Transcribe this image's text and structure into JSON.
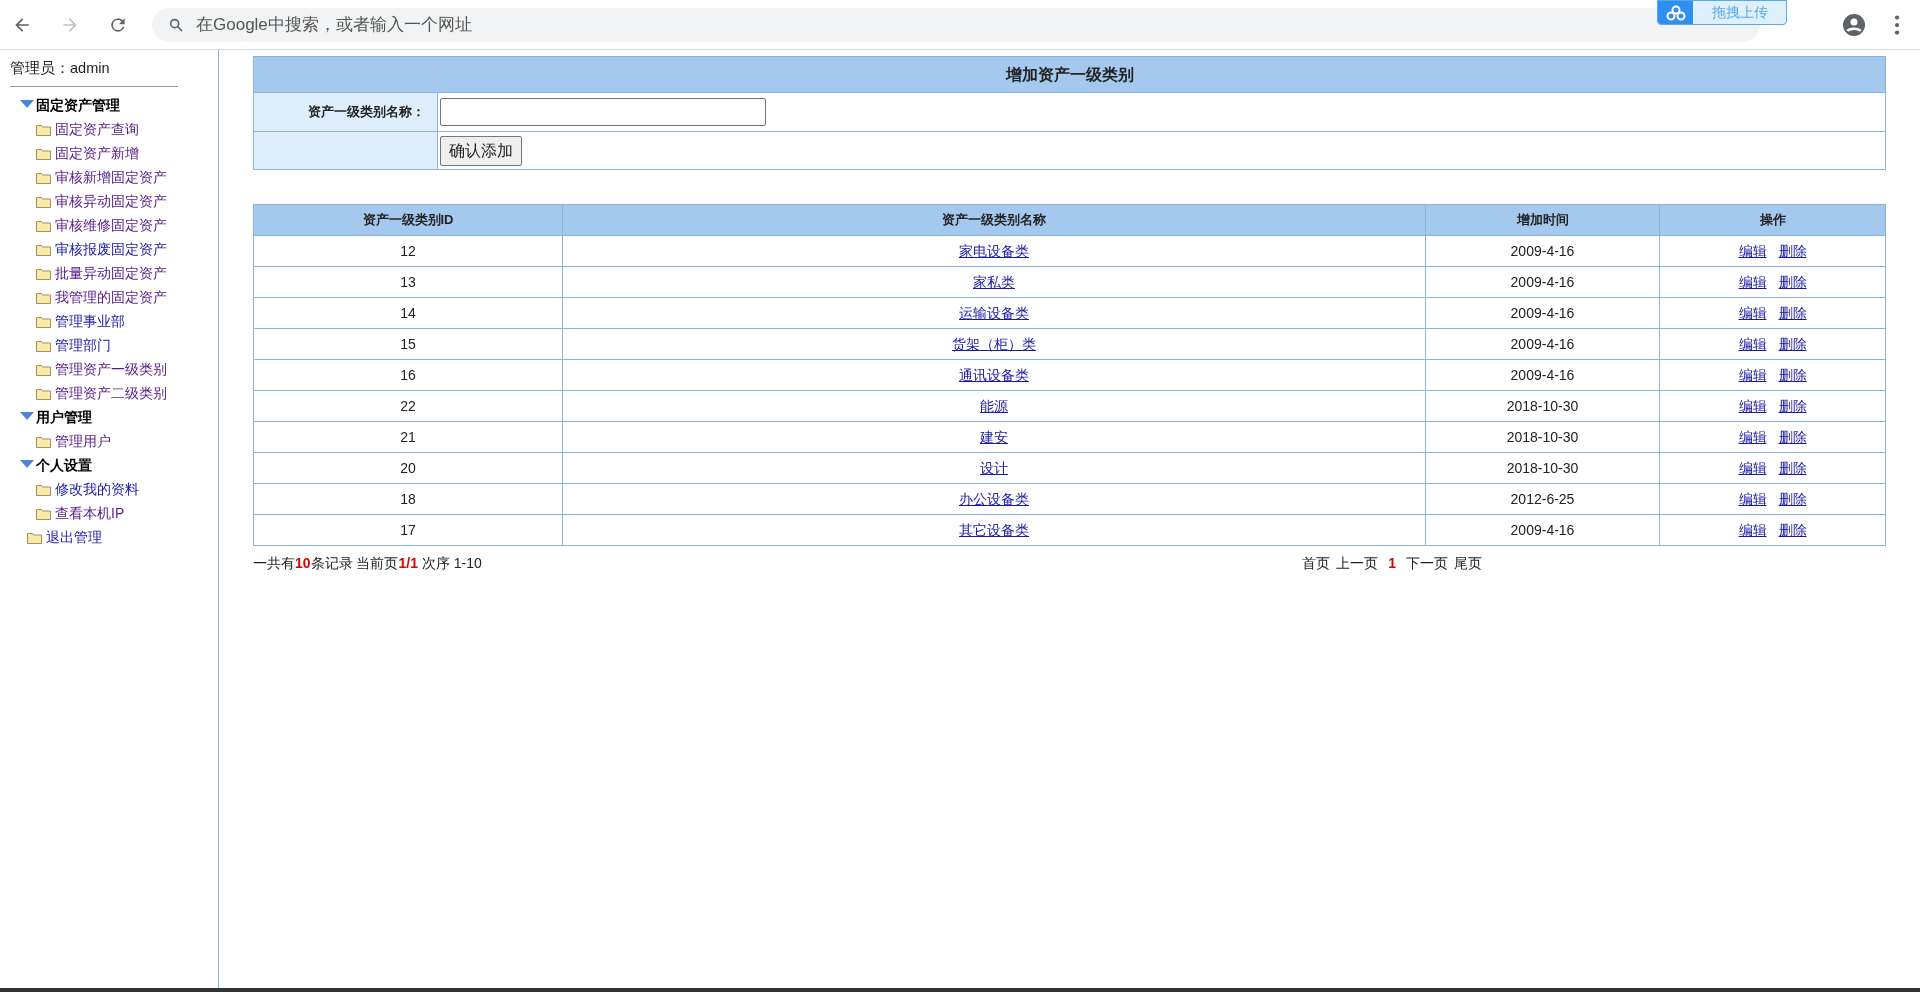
{
  "browser": {
    "address_placeholder": "在Google中搜索，或者输入一个网址",
    "upload_widget": "拖拽上传"
  },
  "sidebar": {
    "admin_label": "管理员：admin",
    "groups": [
      {
        "title": "固定资产管理",
        "expanded": true,
        "items": [
          {
            "label": "固定资产查询",
            "visited": true
          },
          {
            "label": "固定资产新增",
            "visited": true
          },
          {
            "label": "审核新增固定资产",
            "visited": true
          },
          {
            "label": "审核异动固定资产",
            "visited": true
          },
          {
            "label": "审核维修固定资产",
            "visited": true
          },
          {
            "label": "审核报废固定资产",
            "visited": false
          },
          {
            "label": "批量异动固定资产",
            "visited": true
          },
          {
            "label": "我管理的固定资产",
            "visited": true
          },
          {
            "label": "管理事业部",
            "visited": false
          },
          {
            "label": "管理部门",
            "visited": false
          },
          {
            "label": "管理资产一级类别",
            "visited": true
          },
          {
            "label": "管理资产二级类别",
            "visited": true
          }
        ]
      },
      {
        "title": "用户管理",
        "expanded": true,
        "items": [
          {
            "label": "管理用户",
            "visited": true
          }
        ]
      },
      {
        "title": "个人设置",
        "expanded": true,
        "items": [
          {
            "label": "修改我的资料",
            "visited": false
          },
          {
            "label": "查看本机IP",
            "visited": true
          }
        ]
      }
    ],
    "logout": {
      "label": "退出管理",
      "visited": false
    }
  },
  "form": {
    "title": "增加资产一级类别",
    "field_label": "资产一级类别名称：",
    "submit": "确认添加"
  },
  "table": {
    "columns": [
      "资产一级类别ID",
      "资产一级类别名称",
      "增加时间",
      "操作"
    ],
    "rows": [
      {
        "id": "12",
        "name": "家电设备类",
        "date": "2009-4-16",
        "actions": [
          "编辑",
          "删除"
        ]
      },
      {
        "id": "13",
        "name": "家私类",
        "date": "2009-4-16",
        "actions": [
          "编辑",
          "删除"
        ]
      },
      {
        "id": "14",
        "name": "运输设备类",
        "date": "2009-4-16",
        "actions": [
          "编辑",
          "删除"
        ]
      },
      {
        "id": "15",
        "name": "货架（柜）类",
        "date": "2009-4-16",
        "actions": [
          "编辑",
          "删除"
        ]
      },
      {
        "id": "16",
        "name": "通讯设备类",
        "date": "2009-4-16",
        "actions": [
          "编辑",
          "删除"
        ]
      },
      {
        "id": "22",
        "name": "能源",
        "date": "2018-10-30",
        "actions": [
          "编辑",
          "删除"
        ]
      },
      {
        "id": "21",
        "name": "建安",
        "date": "2018-10-30",
        "actions": [
          "编辑",
          "删除"
        ]
      },
      {
        "id": "20",
        "name": "设计",
        "date": "2018-10-30",
        "actions": [
          "编辑",
          "删除"
        ]
      },
      {
        "id": "18",
        "name": "办公设备类",
        "date": "2012-6-25",
        "actions": [
          "编辑",
          "删除"
        ]
      },
      {
        "id": "17",
        "name": "其它设备类",
        "date": "2009-4-16",
        "actions": [
          "编辑",
          "删除"
        ]
      }
    ]
  },
  "pagination": {
    "summary": "一共有**10**条记录 当前页**1/1** 次序 1-10",
    "links": [
      {
        "label": "首页",
        "current": false
      },
      {
        "label": "上一页",
        "current": false
      },
      {
        "label": "1",
        "current": true
      },
      {
        "label": "下一页",
        "current": false
      },
      {
        "label": "尾页",
        "current": false
      }
    ]
  }
}
